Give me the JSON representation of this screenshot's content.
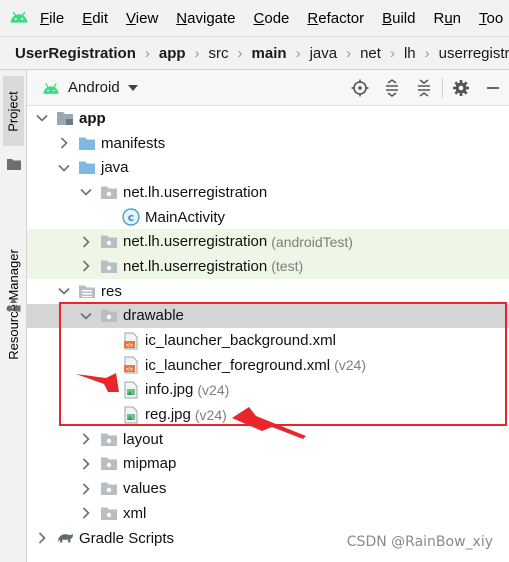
{
  "menubar": {
    "items": [
      {
        "label": "File",
        "mnemonic": "F"
      },
      {
        "label": "Edit",
        "mnemonic": "E"
      },
      {
        "label": "View",
        "mnemonic": "V"
      },
      {
        "label": "Navigate",
        "mnemonic": "N"
      },
      {
        "label": "Code",
        "mnemonic": "C"
      },
      {
        "label": "Refactor",
        "mnemonic": "R"
      },
      {
        "label": "Build",
        "mnemonic": "B"
      },
      {
        "label": "Run",
        "mnemonic": "u"
      },
      {
        "label": "Too",
        "mnemonic": "T"
      }
    ]
  },
  "breadcrumb": [
    "UserRegistration",
    "app",
    "src",
    "main",
    "java",
    "net",
    "lh",
    "userregistration"
  ],
  "side_tabs": {
    "project": "Project",
    "resource_manager": "Resource Manager"
  },
  "tool_window": {
    "view_label": "Android"
  },
  "tree": [
    {
      "label": "app",
      "suffix": "",
      "indent": 0,
      "arrow": "expanded",
      "icon": "module-folder-icon",
      "bold": true
    },
    {
      "label": "manifests",
      "suffix": "",
      "indent": 1,
      "arrow": "collapsed",
      "icon": "folder-icon"
    },
    {
      "label": "java",
      "suffix": "",
      "indent": 1,
      "arrow": "expanded",
      "icon": "folder-icon"
    },
    {
      "label": "net.lh.userregistration",
      "suffix": "",
      "indent": 2,
      "arrow": "expanded",
      "icon": "package-icon"
    },
    {
      "label": "MainActivity",
      "suffix": "",
      "indent": 3,
      "arrow": "none",
      "icon": "class-icon"
    },
    {
      "label": "net.lh.userregistration",
      "suffix": "(androidTest)",
      "indent": 2,
      "arrow": "collapsed",
      "icon": "package-icon",
      "highlight": "green"
    },
    {
      "label": "net.lh.userregistration",
      "suffix": "(test)",
      "indent": 2,
      "arrow": "collapsed",
      "icon": "package-icon",
      "highlight": "green"
    },
    {
      "label": "res",
      "suffix": "",
      "indent": 1,
      "arrow": "expanded",
      "icon": "res-folder-icon"
    },
    {
      "label": "drawable",
      "suffix": "",
      "indent": 2,
      "arrow": "expanded",
      "icon": "package-icon",
      "highlight": "selected"
    },
    {
      "label": "ic_launcher_background.xml",
      "suffix": "",
      "indent": 3,
      "arrow": "none",
      "icon": "xml-file-icon"
    },
    {
      "label": "ic_launcher_foreground.xml",
      "suffix": "(v24)",
      "indent": 3,
      "arrow": "none",
      "icon": "xml-file-icon"
    },
    {
      "label": "info.jpg",
      "suffix": "(v24)",
      "indent": 3,
      "arrow": "none",
      "icon": "image-file-icon"
    },
    {
      "label": "reg.jpg",
      "suffix": "(v24)",
      "indent": 3,
      "arrow": "none",
      "icon": "image-file-icon"
    },
    {
      "label": "layout",
      "suffix": "",
      "indent": 2,
      "arrow": "collapsed",
      "icon": "package-icon"
    },
    {
      "label": "mipmap",
      "suffix": "",
      "indent": 2,
      "arrow": "collapsed",
      "icon": "package-icon"
    },
    {
      "label": "values",
      "suffix": "",
      "indent": 2,
      "arrow": "collapsed",
      "icon": "package-icon"
    },
    {
      "label": "xml",
      "suffix": "",
      "indent": 2,
      "arrow": "collapsed",
      "icon": "package-icon"
    },
    {
      "label": "Gradle Scripts",
      "suffix": "",
      "indent": 0,
      "arrow": "collapsed",
      "icon": "gradle-icon"
    }
  ],
  "watermark": "CSDN @RainBow_xiy",
  "colors": {
    "annotation": "#e8262c",
    "android": "#3ddc84",
    "folder": "#7fb8e0",
    "class": "#3592c4"
  }
}
